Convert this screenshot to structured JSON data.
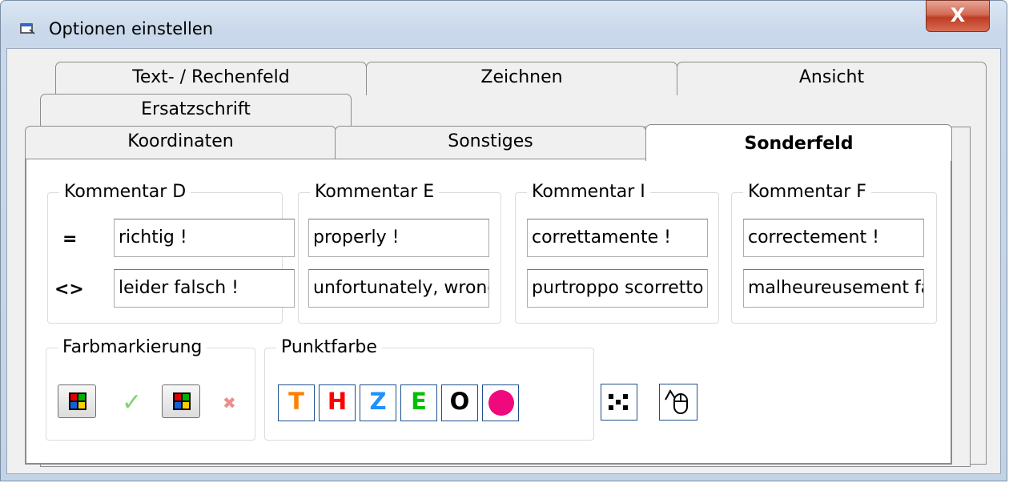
{
  "window": {
    "title": "Optionen einstellen",
    "close_label": "X"
  },
  "tabs_row1": [
    "Text- / Rechenfeld",
    "Zeichnen",
    "Ansicht"
  ],
  "tabs_row2": [
    "Ersatzschrift"
  ],
  "tabs_row3": [
    "Koordinaten",
    "Sonstiges",
    "Sonderfeld"
  ],
  "active_tab": "Sonderfeld",
  "comments": [
    {
      "label": "Kommentar  D",
      "correct": "richtig !",
      "wrong": "leider falsch !"
    },
    {
      "label": "Kommentar  E",
      "correct": "properly !",
      "wrong": "unfortunately, wrong !"
    },
    {
      "label": "Kommentar  I",
      "correct": "correttamente !",
      "wrong": "purtroppo scorretto !"
    },
    {
      "label": "Kommentar  F",
      "correct": "correctement !",
      "wrong": "malheureusement faux !"
    }
  ],
  "operators": {
    "equal": "=",
    "not_equal": "<>"
  },
  "farbmarkierung": {
    "label": "Farbmarkierung",
    "check_symbol": "✓",
    "cross_symbol": "✖"
  },
  "punktfarbe": {
    "label": "Punktfarbe",
    "buttons": [
      {
        "text": "T",
        "color": "#ff8000"
      },
      {
        "text": "H",
        "color": "#ff0000"
      },
      {
        "text": "Z",
        "color": "#1e90ff"
      },
      {
        "text": "E",
        "color": "#00c000"
      },
      {
        "text": "O",
        "color": "#000000"
      }
    ],
    "dot_color": "#f0087d"
  },
  "extra_icons": [
    "scatter-points-icon",
    "mouse-cursor-icon"
  ]
}
